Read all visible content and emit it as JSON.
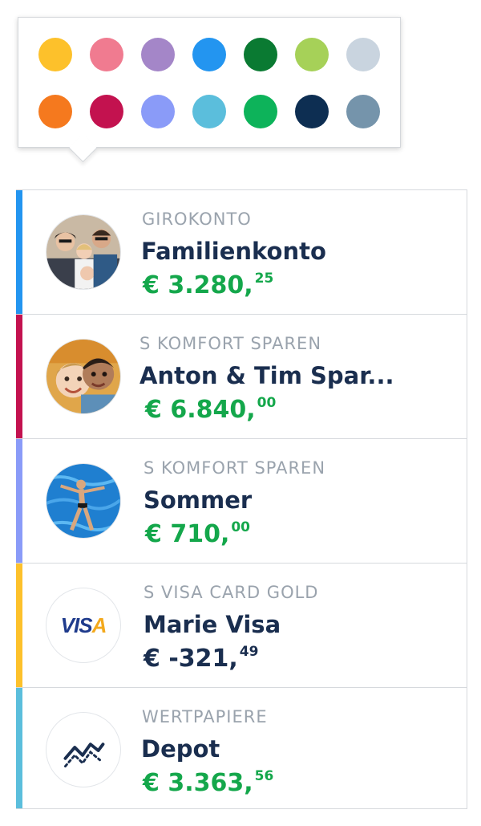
{
  "color_picker": {
    "row1": [
      "#fdc12b",
      "#f07b90",
      "#a486c8",
      "#2395f0",
      "#0a7a32",
      "#a6d158",
      "#c9d4df"
    ],
    "row2": [
      "#f5791e",
      "#c3124f",
      "#8a9bf8",
      "#5bbedc",
      "#0db35a",
      "#0d2e52",
      "#7594ab"
    ]
  },
  "accounts": [
    {
      "type": "GIROKONTO",
      "name": "Familienkonto",
      "amount_main": "€ 3.280,",
      "amount_cents": "25",
      "stripe_color": "#2395f0",
      "amount_color": "green",
      "avatar": "family-photo"
    },
    {
      "type": "S KOMFORT SPAREN",
      "name": "Anton & Tim Spar...",
      "amount_main": "€ 6.840,",
      "amount_cents": "00",
      "stripe_color": "#c3124f",
      "amount_color": "green",
      "avatar": "kids-photo"
    },
    {
      "type": "S KOMFORT SPAREN",
      "name": "Sommer",
      "amount_main": "€ 710,",
      "amount_cents": "00",
      "stripe_color": "#8a9bf8",
      "amount_color": "green",
      "avatar": "pool-photo"
    },
    {
      "type": "S VISA CARD GOLD",
      "name": "Marie Visa",
      "amount_main": "€ -321,",
      "amount_cents": "49",
      "stripe_color": "#fdc12b",
      "amount_color": "navy",
      "avatar": "visa-logo",
      "avatar_text": "VISA"
    },
    {
      "type": "WERTPAPIERE",
      "name": "Depot",
      "amount_main": "€ 3.363,",
      "amount_cents": "56",
      "stripe_color": "#5bbedc",
      "amount_color": "green",
      "avatar": "chart-trend-icon"
    }
  ]
}
